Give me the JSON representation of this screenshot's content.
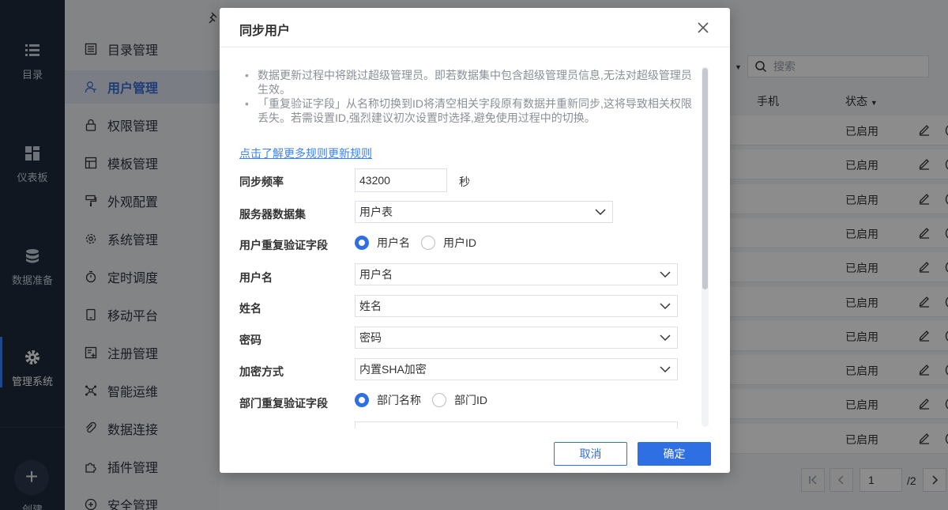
{
  "rail": {
    "items": [
      {
        "label": "目录",
        "icon": "list-icon"
      },
      {
        "label": "仪表板",
        "icon": "dashboard-grid-icon"
      },
      {
        "label": "数据准备",
        "icon": "database-icon"
      },
      {
        "label": "管理系统",
        "icon": "gear-icon"
      }
    ],
    "create_label": "创建",
    "active_index": 3
  },
  "subnav": {
    "items": [
      {
        "label": "目录管理",
        "icon": "catalog-icon"
      },
      {
        "label": "用户管理",
        "icon": "user-icon"
      },
      {
        "label": "权限管理",
        "icon": "lock-icon"
      },
      {
        "label": "模板管理",
        "icon": "template-icon"
      },
      {
        "label": "外观配置",
        "icon": "paint-roller-icon"
      },
      {
        "label": "系统管理",
        "icon": "settings-icon"
      },
      {
        "label": "定时调度",
        "icon": "timer-icon"
      },
      {
        "label": "移动平台",
        "icon": "tablet-icon"
      },
      {
        "label": "注册管理",
        "icon": "register-icon"
      },
      {
        "label": "智能运维",
        "icon": "network-icon"
      },
      {
        "label": "数据连接",
        "icon": "link-icon"
      },
      {
        "label": "插件管理",
        "icon": "plugin-icon"
      },
      {
        "label": "安全管理",
        "icon": "shield-icon"
      }
    ],
    "active_index": 1
  },
  "main": {
    "search_placeholder": "搜索",
    "columns": {
      "phone": "手机",
      "status": "状态"
    },
    "rows": [
      {
        "status": "已启用"
      },
      {
        "status": "已启用"
      },
      {
        "status": "已启用"
      },
      {
        "status": "已启用"
      },
      {
        "status": "已启用"
      },
      {
        "status": "已启用"
      },
      {
        "status": "已启用"
      },
      {
        "status": "已启用"
      },
      {
        "status": "已启用"
      },
      {
        "status": "已启用"
      }
    ],
    "pager": {
      "current": "1",
      "total": "/2"
    }
  },
  "dialog": {
    "title": "同步用户",
    "notes": [
      "数据更新过程中将跳过超级管理员。即若数据集中包含超级管理员信息,无法对超级管理员生效。",
      "「重复验证字段」从名称切换到ID将清空相关字段原有数据并重新同步,这将导致相关权限丢失。若需设置ID,强烈建议初次设置时选择,避免使用过程中的切换。"
    ],
    "learn_more": "点击了解更多规则更新规则",
    "fields": {
      "sync_freq": {
        "label": "同步频率",
        "value": "43200",
        "unit": "秒"
      },
      "server_dataset": {
        "label": "服务器数据集",
        "value": "用户表"
      },
      "user_verify": {
        "label": "用户重复验证字段",
        "options": [
          "用户名",
          "用户ID"
        ],
        "selected": "用户名"
      },
      "username": {
        "label": "用户名",
        "value": "用户名"
      },
      "name": {
        "label": "姓名",
        "value": "姓名"
      },
      "password": {
        "label": "密码",
        "value": "密码"
      },
      "encrypt": {
        "label": "加密方式",
        "value": "内置SHA加密"
      },
      "dept_verify": {
        "label": "部门重复验证字段",
        "options": [
          "部门名称",
          "部门ID"
        ],
        "selected": "部门名称"
      }
    },
    "cancel_label": "取消",
    "ok_label": "确定"
  },
  "colors": {
    "rail_bg": "#1e2a3b",
    "accent": "#2f6fe4",
    "subnav_bg": "#eef0f4"
  }
}
